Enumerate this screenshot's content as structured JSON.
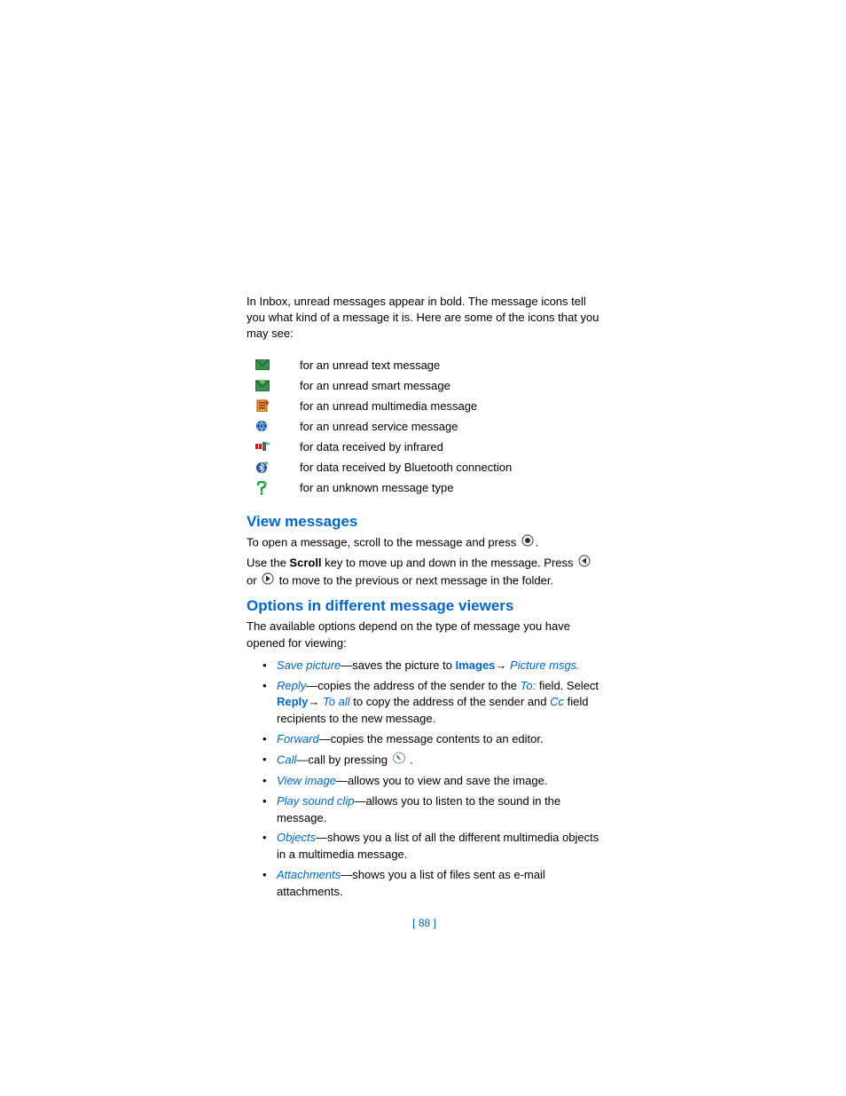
{
  "intro": "In Inbox, unread messages appear in bold. The message icons tell you what kind of a message it is. Here are some of the icons that you may see:",
  "icons": [
    {
      "name": "unread-text-icon",
      "label": "for an unread text message"
    },
    {
      "name": "unread-smart-icon",
      "label": "for an unread smart message"
    },
    {
      "name": "unread-mms-icon",
      "label": "for an unread multimedia message"
    },
    {
      "name": "unread-service-icon",
      "label": "for an unread service message"
    },
    {
      "name": "infrared-icon",
      "label": "for data received by infrared"
    },
    {
      "name": "bluetooth-icon",
      "label": "for data received by Bluetooth connection"
    },
    {
      "name": "unknown-msg-icon",
      "label": "for an unknown message type"
    }
  ],
  "view_heading": "View messages",
  "view": {
    "open1": "To open a message, scroll to the message and press ",
    "open2": ".",
    "scroll1": "Use the ",
    "scroll_bold": "Scroll",
    "scroll2": " key to move up and down in the message. Press ",
    "scroll_or": " or ",
    "scroll_end": " to move to the previous or next message in the folder."
  },
  "options_heading": "Options in different message viewers",
  "options_intro": "The available options depend on the type of message you have opened for viewing:",
  "opts": {
    "save_picture": "Save picture",
    "save_picture_text": "—saves the picture to ",
    "images": "Images",
    "arrow": "→ ",
    "picture_msgs": "Picture msgs.",
    "reply": "Reply",
    "reply_text1": "—copies the address of the sender to the ",
    "to_field": "To:",
    "reply_text2": " field. Select ",
    "reply_bold": "Reply",
    "reply_arrow": "→ ",
    "to_all": "To all",
    "reply_text3": " to copy the address of the sender and ",
    "cc": "Cc",
    "reply_text4": " field recipients to the new message.",
    "forward": "Forward",
    "forward_text": "—copies the message contents to an editor.",
    "call": "Call",
    "call_text": "—call by pressing ",
    "call_end": " .",
    "view_image": "View image",
    "view_image_text": "—allows you to view and save the image.",
    "play_sound": "Play sound clip",
    "play_sound_text": "—allows you to listen to the sound in the message.",
    "objects": "Objects",
    "objects_text": "—shows you a list of all the different multimedia objects in a multimedia message.",
    "attachments": "Attachments",
    "attachments_text": "—shows you a list of files sent as e-mail attachments."
  },
  "page_number": "[ 88 ]"
}
